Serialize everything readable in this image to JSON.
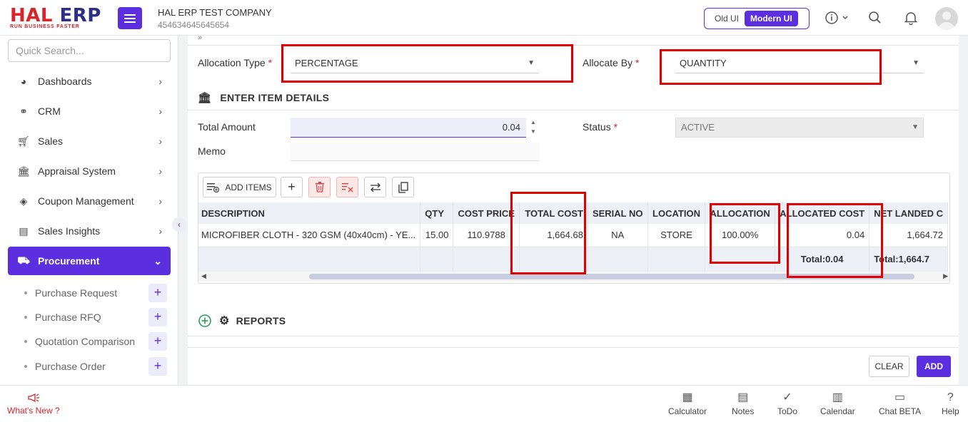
{
  "brand": {
    "logo_main_a": "HAL ",
    "logo_main_b": "ERP",
    "logo_tagline": "RUN BUSINESS FASTER"
  },
  "company": {
    "name": "HAL ERP TEST COMPANY",
    "code": "454634645645654"
  },
  "ui_toggle": {
    "old": "Old UI",
    "modern": "Modern UI",
    "selected": "Modern UI"
  },
  "search": {
    "placeholder": "Quick Search..."
  },
  "sidebar": {
    "items": [
      {
        "label": "Dashboards",
        "icon": "palette-icon"
      },
      {
        "label": "CRM",
        "icon": "handshake-icon"
      },
      {
        "label": "Sales",
        "icon": "cart-icon"
      },
      {
        "label": "Appraisal System",
        "icon": "bank-icon"
      },
      {
        "label": "Coupon Management",
        "icon": "tag-icon"
      },
      {
        "label": "Sales Insights",
        "icon": "report-icon"
      },
      {
        "label": "Procurement",
        "icon": "truck-icon",
        "active": true
      }
    ],
    "sub_items": [
      {
        "label": "Purchase Request"
      },
      {
        "label": "Purchase RFQ"
      },
      {
        "label": "Quotation Comparison"
      },
      {
        "label": "Purchase Order"
      }
    ]
  },
  "form": {
    "allocation_type_label": "Allocation Type",
    "allocation_type_value": "PERCENTAGE",
    "allocate_by_label": "Allocate By",
    "allocate_by_value": "QUANTITY",
    "section_title": "ENTER ITEM DETAILS",
    "total_amount_label": "Total Amount",
    "total_amount_value": "0.04",
    "status_label": "Status",
    "status_value": "ACTIVE",
    "memo_label": "Memo",
    "required_mark": "*"
  },
  "grid": {
    "toolbar": {
      "add_items": "ADD ITEMS"
    },
    "columns": [
      "DESCRIPTION",
      "QTY",
      "COST PRICE",
      "TOTAL COST",
      "SERIAL NO",
      "LOCATION",
      "ALLOCATION",
      "ALLOCATED COST",
      "NET LANDED C"
    ],
    "rows": [
      {
        "description": "MICROFIBER CLOTH - 320 GSM (40x40cm) - YE...",
        "qty": "15.00",
        "cost_price": "110.9788",
        "total_cost": "1,664.68",
        "serial_no": "NA",
        "location": "STORE",
        "allocation": "100.00%",
        "allocated_cost": "0.04",
        "net_landed": "1,664.72"
      }
    ],
    "totals": {
      "allocated_cost": "Total:0.04",
      "net_landed": "Total:1,664.7"
    }
  },
  "reports": {
    "title": "REPORTS"
  },
  "actions": {
    "clear": "CLEAR",
    "add": "ADD"
  },
  "bottombar": {
    "whats_new": "What's New ?",
    "items": [
      {
        "label": "Calculator",
        "icon": "calculator-icon"
      },
      {
        "label": "Notes",
        "icon": "notes-icon"
      },
      {
        "label": "ToDo",
        "icon": "todo-icon"
      },
      {
        "label": "Calendar",
        "icon": "calendar-icon"
      },
      {
        "label": "Chat BETA",
        "icon": "chat-icon"
      },
      {
        "label": "Help",
        "icon": "help-icon"
      }
    ]
  },
  "colors": {
    "accent": "#5b2fe0",
    "brand_red": "#d8252b",
    "brand_navy": "#2d2f84",
    "highlight_box": "#e00000"
  }
}
